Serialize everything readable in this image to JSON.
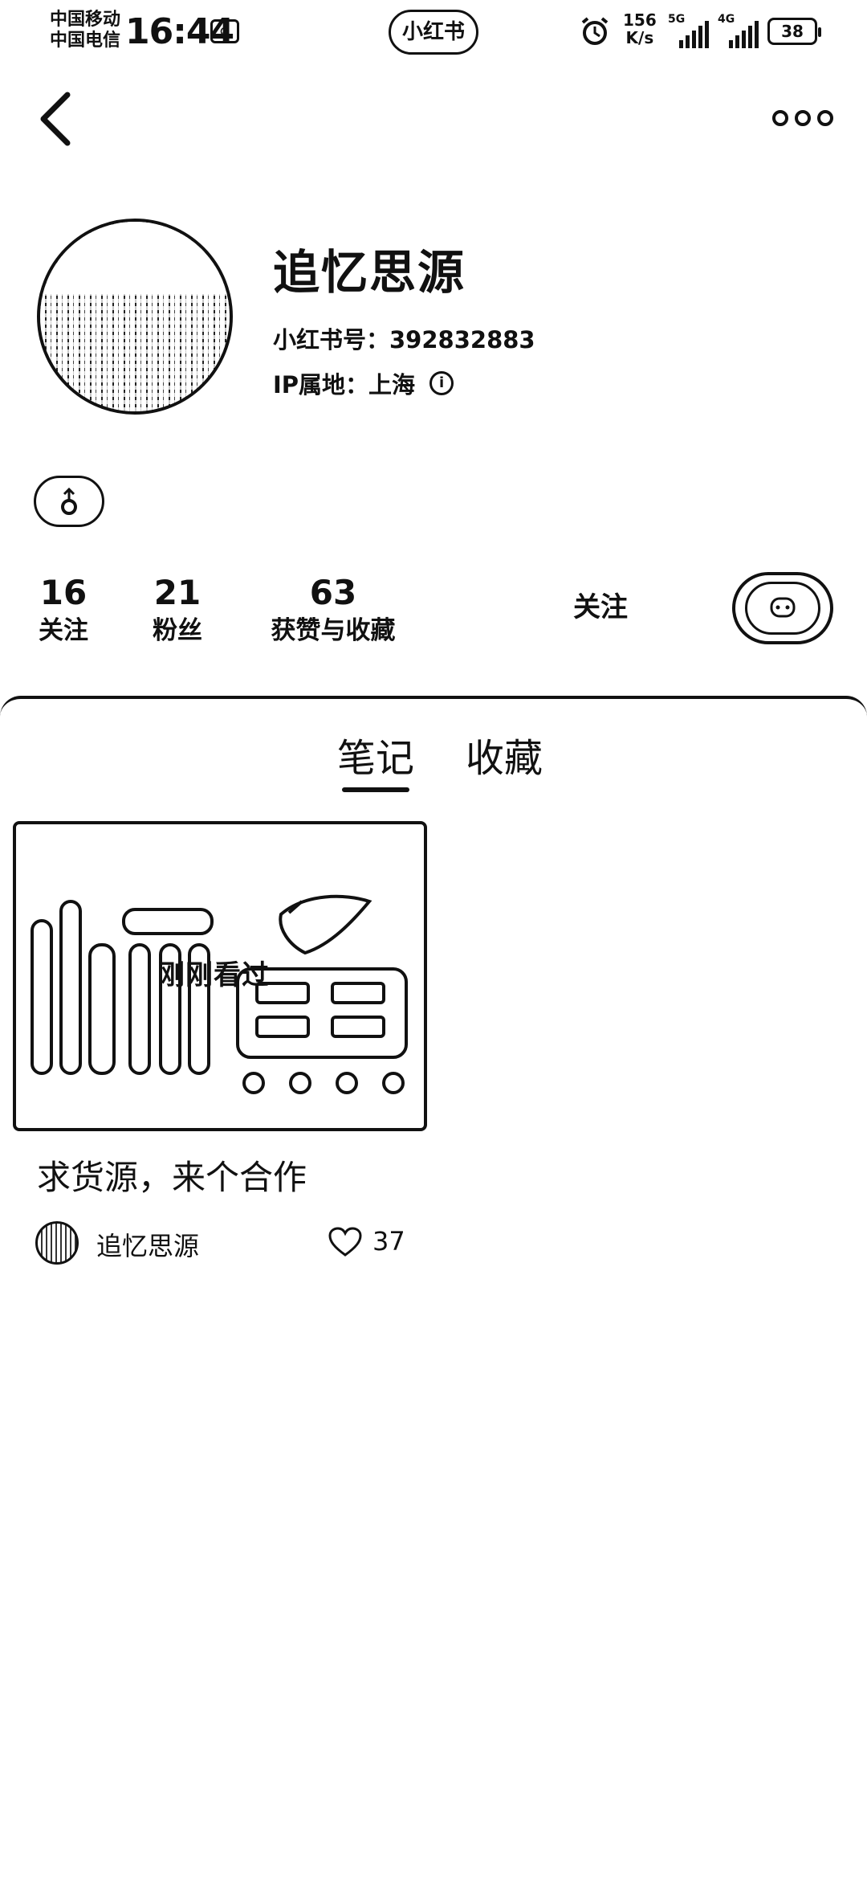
{
  "status_bar": {
    "carrier_1": "中国移动",
    "carrier_2": "中国电信",
    "time": "16:44",
    "silent_icon": "vibrate-off-icon",
    "app_name": "小红书",
    "net_speed_value": "156",
    "net_speed_unit": "K/s",
    "signal_1_tag": "5G",
    "signal_2_tag": "4G",
    "battery": "38"
  },
  "nav": {
    "back_icon": "chevron-left-icon",
    "more_icon": "more-dots-icon"
  },
  "profile": {
    "nickname": "追忆思源",
    "red_id": "小红书号：392832883",
    "ip_location": "IP属地：上海",
    "gender_icon": "gender-icon"
  },
  "stats": {
    "following_count": "16",
    "following_label": "关注",
    "followers_count": "21",
    "followers_label": "粉丝",
    "likes_count": "63",
    "likes_label": "获赞与收藏"
  },
  "actions": {
    "follow_label": "关注",
    "message_icon": "chat-bubble-icon"
  },
  "tabs": [
    {
      "label": "笔记",
      "active": true
    },
    {
      "label": "收藏",
      "active": false
    }
  ],
  "notes": [
    {
      "badge": "刚刚看过",
      "title": "求货源，来个合作",
      "author": "追忆思源",
      "likes": "37"
    }
  ],
  "colors": {
    "text": "#111111",
    "background": "#ffffff"
  }
}
